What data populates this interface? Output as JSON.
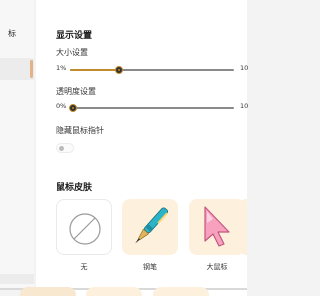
{
  "sidebar": {
    "items": [
      {
        "label": "标"
      }
    ]
  },
  "display_settings": {
    "title": "显示设置",
    "size": {
      "label": "大小设置",
      "min_label": "1%",
      "max_label": "10",
      "value_fraction": 0.3
    },
    "opacity": {
      "label": "透明度设置",
      "min_label": "0%",
      "max_label": "10",
      "value_fraction": 0.0
    },
    "hide_pointer": {
      "label": "隐藏鼠标指针",
      "enabled": false
    }
  },
  "skins": {
    "title": "鼠标皮肤",
    "items": [
      {
        "label": "无",
        "icon": "no-symbol-icon"
      },
      {
        "label": "钢笔",
        "icon": "pen-icon"
      },
      {
        "label": "大鼠标",
        "icon": "large-cursor-icon"
      }
    ]
  },
  "colors": {
    "accent": "#c08b2c",
    "card_bg": "#fdf1de",
    "cursor_pink": "#f7a1bf"
  }
}
